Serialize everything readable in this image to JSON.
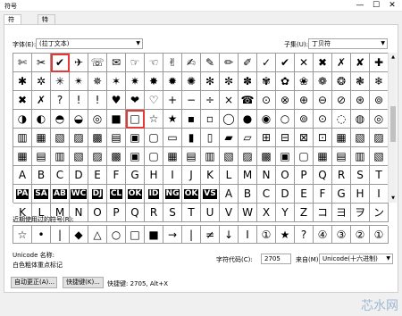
{
  "window": {
    "title": "符号",
    "min": "—",
    "max": "☐",
    "close": "✕"
  },
  "tabs": [
    "符号(S)",
    "特殊字符(P)"
  ],
  "font": {
    "label": "字体(E):",
    "value": "(拉丁文本)"
  },
  "subset": {
    "label": "子集(U):",
    "value": "丁贝符"
  },
  "grid_rows": [
    [
      "✄",
      "✂",
      "✔",
      "✈",
      "☏",
      "✉",
      "☞",
      "☜",
      "✌",
      "✍",
      "✎",
      "✏",
      "✐",
      "✓",
      "✔",
      "✕",
      "✖",
      "✗",
      "✘",
      "✚"
    ],
    [
      "✱",
      "✲",
      "✳",
      "✴",
      "✵",
      "✶",
      "✷",
      "✸",
      "✹",
      "✺",
      "✻",
      "✼",
      "✽",
      "✾",
      "✿",
      "❀",
      "❁",
      "❂",
      "❃",
      "❄"
    ],
    [
      "✖",
      "✗",
      "?",
      "!",
      "!",
      "♥",
      "❤",
      "♡",
      "+",
      "−",
      "÷",
      "×",
      "☎",
      "⊙",
      "⊗",
      "⊕",
      "⊖",
      "⊘",
      "⊛",
      "⊚"
    ],
    [
      "◑",
      "◐",
      "◓",
      "◒",
      "◎",
      "■",
      "□",
      "☆",
      "★",
      "▪",
      "▫",
      "◯",
      "●",
      "◉",
      "○",
      "⊚",
      "⊙",
      "◌",
      "◍",
      "◎"
    ],
    [
      "▥",
      "▦",
      "▧",
      "▨",
      "▩",
      "▤",
      "▣",
      "▢",
      "▭",
      "▮",
      "▯",
      "▰",
      "▱",
      "⊞",
      "⊟",
      "⊠",
      "⊡",
      "▦",
      "▧",
      "▨"
    ],
    [
      "▦",
      "▤",
      "▥",
      "▧",
      "▨",
      "▩",
      "▣",
      "▢",
      "▦",
      "▤",
      "▥",
      "▧",
      "▨",
      "▩",
      "▣",
      "▢",
      "▦",
      "▤",
      "▥",
      "▧"
    ],
    [
      "A",
      "B",
      "C",
      "D",
      "E",
      "F",
      "G",
      "H",
      "I",
      "J",
      "K",
      "L",
      "M",
      "N",
      "O",
      "P",
      "Q",
      "R",
      "S",
      "T"
    ],
    [
      "PA",
      "SA",
      "AB",
      "WC",
      "DJ",
      "CL",
      "OK",
      "ID",
      "NG",
      "OK",
      "VS",
      "A",
      "B",
      "C",
      "D",
      "E",
      "F",
      "G",
      "H",
      "I"
    ],
    [
      "K",
      "L",
      "M",
      "N",
      "O",
      "P",
      "Q",
      "R",
      "S",
      "T",
      "U",
      "V",
      "W",
      "X",
      "Y",
      "Z",
      "コ",
      "ヨ",
      "ヲ",
      "ン"
    ]
  ],
  "recent_label": "近期使用过的符号(R):",
  "recent": [
    "☆",
    "•",
    "|",
    "◆",
    "△",
    "○",
    "□",
    "■",
    "→",
    "|",
    "≠",
    "↓",
    "I",
    "①",
    "★",
    "?",
    "④",
    "③",
    "②",
    "①"
  ],
  "unicode_name_label": "Unicode 名称:",
  "unicode_name_value": "白色粗体重点标记",
  "char_code_label": "字符代码(C):",
  "char_code_value": "2705",
  "from_label": "来自(M):",
  "from_value": "Unicode(十六进制)",
  "autocorrect_btn": "自动更正(A)...",
  "shortcut_btn": "快捷键(K)...",
  "shortcut_text": "快捷键: 2705, Alt+X",
  "watermark": "芯水网"
}
